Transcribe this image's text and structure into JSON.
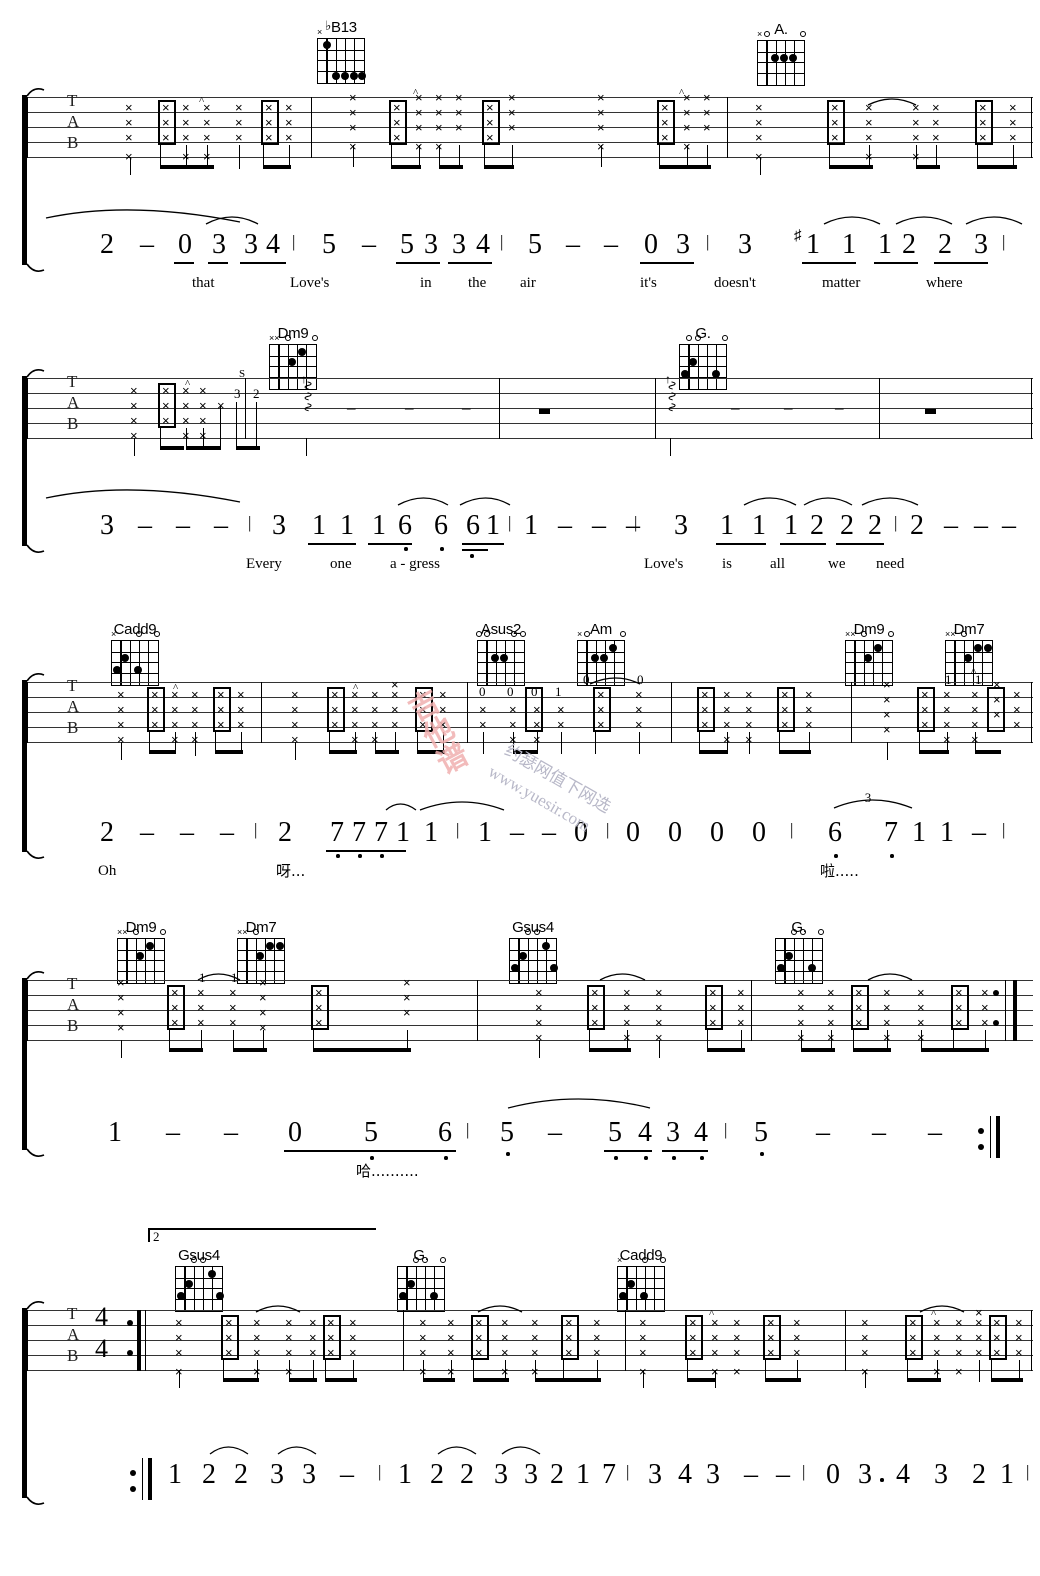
{
  "document": {
    "type": "guitar-tablature-with-numbered-notation",
    "time_signature": {
      "upper": "4",
      "lower": "4"
    },
    "tab_clef_letters": [
      "T",
      "A",
      "B"
    ]
  },
  "watermark": {
    "seal_text": "吉他谱",
    "site_cn": "约瑟网值下网选",
    "site_url": "www.yuesir.com"
  },
  "systems": [
    {
      "id": "system-1",
      "chords": [
        {
          "name": "♭B13",
          "flat": true,
          "label": "B13"
        },
        {
          "name": "A."
        }
      ],
      "numbers": [
        "2",
        "–",
        "0",
        "3",
        "3",
        "4",
        "5",
        "–",
        "5",
        "3",
        "3",
        "4",
        "5",
        "–",
        "–",
        "0",
        "3",
        "3",
        "1",
        "1",
        "1",
        "2",
        "2",
        "3"
      ],
      "lyrics": [
        "that",
        "Love's",
        "in",
        "the",
        "air",
        "it's",
        "doesn't",
        "matter",
        "where"
      ],
      "accidental": "♯"
    },
    {
      "id": "system-2",
      "chords": [
        {
          "name": "Dm9"
        },
        {
          "name": "G."
        }
      ],
      "slide_marker": "S",
      "slide_frets": [
        "3",
        "2"
      ],
      "numbers": [
        "3",
        "–",
        "–",
        "–",
        "3",
        "1",
        "1",
        "1",
        "6",
        "6",
        "6",
        "1",
        "1",
        "–",
        "–",
        "–",
        "3",
        "1",
        "1",
        "1",
        "2",
        "2",
        "2",
        "2",
        "–",
        "–",
        "–"
      ],
      "lyrics": [
        "Every",
        "one",
        "a - gress",
        "Love's",
        "is",
        "all",
        "we",
        "need"
      ]
    },
    {
      "id": "system-3",
      "chords": [
        {
          "name": "Cadd9"
        },
        {
          "name": "Asus2"
        },
        {
          "name": "Am"
        },
        {
          "name": "Dm9"
        },
        {
          "name": "Dm7"
        }
      ],
      "numbers": [
        "2",
        "–",
        "–",
        "–",
        "2",
        "7",
        "7",
        "7",
        "1",
        "1",
        "1",
        "–",
        "–",
        "0",
        "0",
        "0",
        "0",
        "0",
        "6",
        "7",
        "1",
        "1",
        "–"
      ],
      "triplet": "3",
      "lyrics": [
        "Oh",
        "呀...",
        "啦....."
      ]
    },
    {
      "id": "system-4",
      "chords": [
        {
          "name": "Dm9"
        },
        {
          "name": "Dm7"
        },
        {
          "name": "Gsus4"
        },
        {
          "name": "G."
        }
      ],
      "numbers": [
        "1",
        "–",
        "–",
        "0",
        "5",
        "6",
        "5",
        "–",
        "5",
        "4",
        "3",
        "4",
        "5",
        "–",
        "–",
        "–"
      ],
      "lyrics": [
        "哈.........."
      ],
      "end_repeat": true
    },
    {
      "id": "system-5",
      "volta": "2",
      "chords": [
        {
          "name": "Gsus4"
        },
        {
          "name": "G."
        },
        {
          "name": "Cadd9"
        }
      ],
      "numbers": [
        "1",
        "2",
        "2",
        "3",
        "3",
        "–",
        "1",
        "2",
        "2",
        "3",
        "3",
        "2",
        "1",
        "7",
        "3",
        "4",
        "3",
        "–",
        "–",
        "0",
        "3",
        "4",
        "3",
        "2",
        "1"
      ],
      "dotted_mark": "•",
      "start_repeat": true
    }
  ]
}
